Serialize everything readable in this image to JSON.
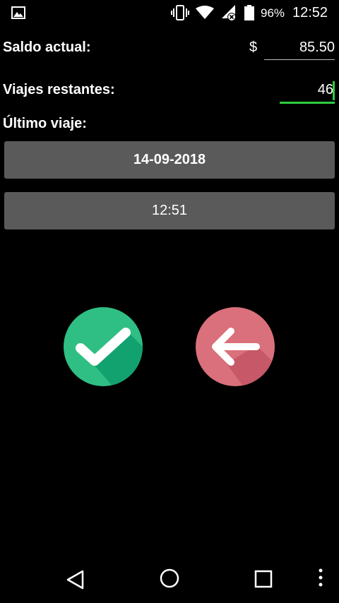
{
  "status_bar": {
    "battery_percent": "96%",
    "time": "12:52",
    "icons": [
      "gallery-icon",
      "vibrate-icon",
      "wifi-icon",
      "signal-icon",
      "battery-icon"
    ]
  },
  "form": {
    "saldo_label": "Saldo actual:",
    "currency_symbol": "$",
    "saldo_value": "85.50",
    "viajes_label": "Viajes restantes:",
    "viajes_value": "46",
    "ultimo_label": "Último viaje:",
    "date_button": "14-09-2018",
    "time_button": "12:51"
  },
  "actions": {
    "confirm_icon": "check-icon",
    "back_icon": "arrow-left-icon",
    "confirm_color": "#2fbf84",
    "back_color": "#d9707b"
  },
  "nav_bar": {
    "icons": [
      "nav-back-icon",
      "nav-home-icon",
      "nav-recents-icon",
      "overflow-menu-icon"
    ]
  }
}
